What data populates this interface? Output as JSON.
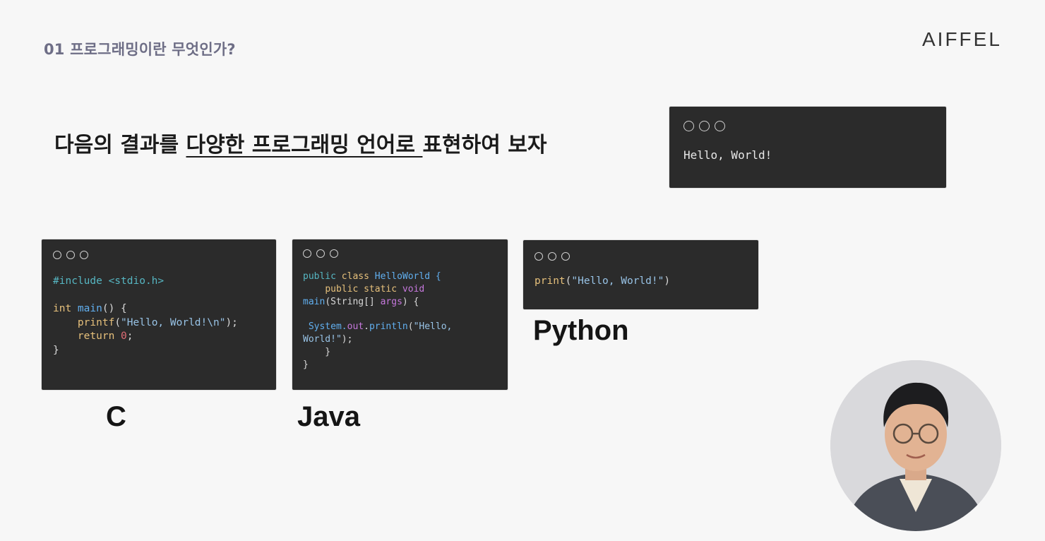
{
  "header": {
    "section_title": "01 프로그래밍이란 무엇인가?",
    "logo_text": "AIFFEL"
  },
  "headline": {
    "part1": "다음의 결과를 ",
    "underlined": "다양한 프로그래밍 언어로 ",
    "part2": "표현하여 보자"
  },
  "output_terminal": {
    "text": "Hello, World!"
  },
  "c_example": {
    "label": "C",
    "lines": {
      "l1_pp": "#include <stdio.h>",
      "l3_kw": "int",
      "l3_fn": " main",
      "l3_rest": "() {",
      "l4_indent": "    ",
      "l4_fn": "printf",
      "l4_p1": "(",
      "l4_str": "\"Hello, World!\\n\"",
      "l4_p2": ");",
      "l5_indent": "    ",
      "l5_kw": "return",
      "l5_sp": " ",
      "l5_num": "0",
      "l5_end": ";",
      "l6": "}"
    }
  },
  "java_example": {
    "label": "Java",
    "lines": {
      "l1_kw1": "public",
      "l1_sp": " ",
      "l1_kw2": "class",
      "l1_rest": " HelloWorld {",
      "l2_indent": "    ",
      "l2_kw1": "public",
      "l2_sp1": " ",
      "l2_kw2": "static",
      "l2_sp2": " ",
      "l2_kw3": "void",
      "l3_fn": "main",
      "l3_p1": "(String[] ",
      "l3_arg": "args",
      "l3_p2": ") {",
      "l5_indent": " ",
      "l5_obj": "System.",
      "l5_out": "out",
      "l5_dot": ".",
      "l5_fn": "println",
      "l5_p": "(",
      "l5_str": "\"Hello,",
      "l6_str": "World!\"",
      "l6_end": ");",
      "l7": "    }",
      "l8": "}"
    }
  },
  "python_example": {
    "label": "Python",
    "lines": {
      "l1_fn": "print",
      "l1_p1": "(",
      "l1_str": "\"Hello, World!\"",
      "l1_p2": ")"
    }
  },
  "colors": {
    "background": "#f7f7f7",
    "terminal_bg": "#2b2b2b",
    "section_title": "#6e6e86"
  }
}
